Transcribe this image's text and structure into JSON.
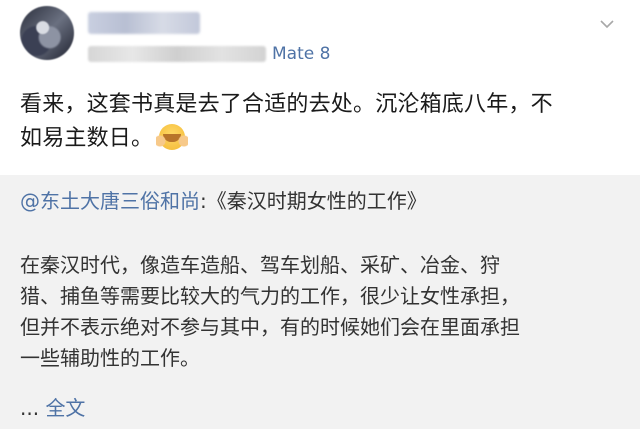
{
  "header": {
    "device": "Mate 8"
  },
  "post": {
    "text_line1": "看来，这套书真是去了合适的去处。沉沦箱底八年，不",
    "text_line2": "如易主数日。"
  },
  "quote": {
    "mention": "@东土大唐三俗和尚",
    "title_sep": ":",
    "title": "《秦汉时期女性的工作》",
    "body_lines": [
      "在秦汉时代，像造车造船、驾车划船、采矿、冶金、狩",
      "猎、捕鱼等需要比较大的气力的工作，很少让女性承担，",
      "但并不表示绝对不参与其中，有的时候她们会在里面承担",
      "一些辅助性的工作。"
    ],
    "ellipsis": "...",
    "fulltext": "全文"
  },
  "colors": {
    "link": "#4f73a6",
    "card_bg": "#f2f2f2"
  },
  "icons": {
    "emoji": "hugging-face-emoji-icon",
    "chevron": "chevron-down-icon"
  }
}
